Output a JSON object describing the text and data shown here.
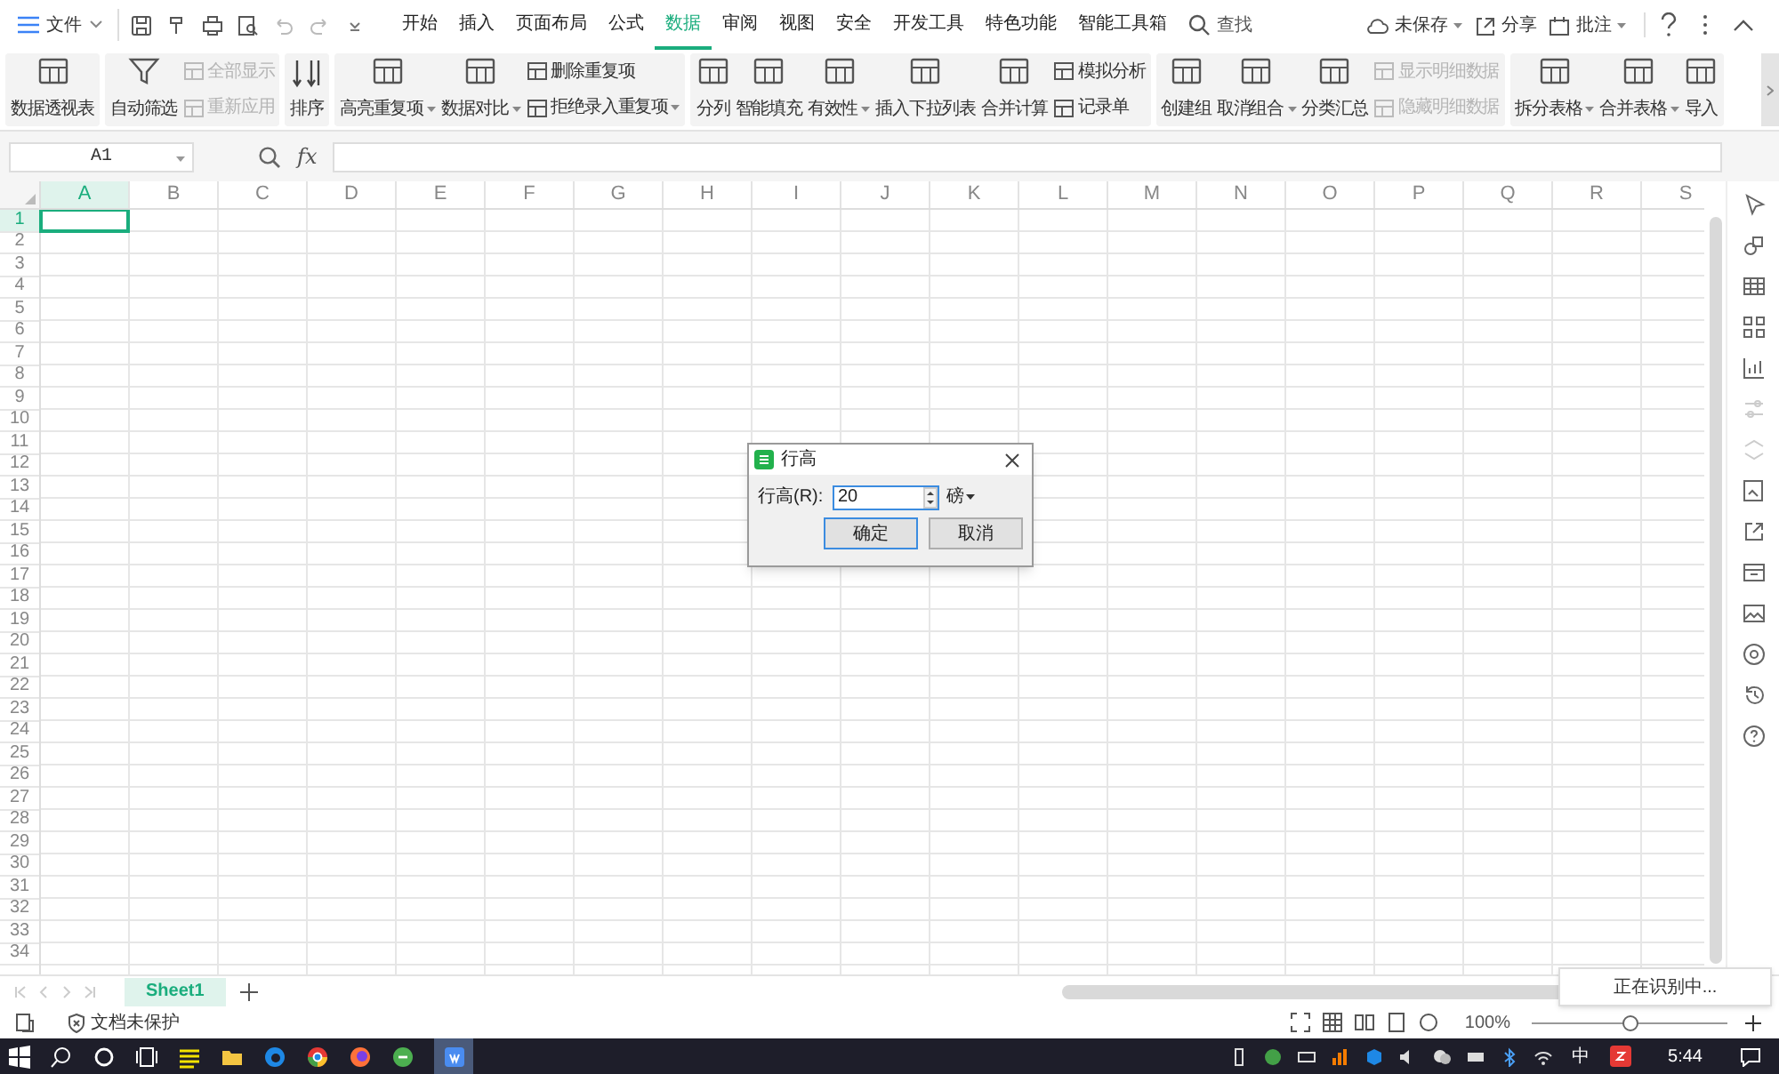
{
  "menu": {
    "file": "文件",
    "tabs": [
      {
        "label": "开始",
        "selected": false
      },
      {
        "label": "插入",
        "selected": false
      },
      {
        "label": "页面布局",
        "selected": false
      },
      {
        "label": "公式",
        "selected": false
      },
      {
        "label": "数据",
        "selected": true
      },
      {
        "label": "审阅",
        "selected": false
      },
      {
        "label": "视图",
        "selected": false
      },
      {
        "label": "安全",
        "selected": false
      },
      {
        "label": "开发工具",
        "selected": false
      },
      {
        "label": "特色功能",
        "selected": false
      },
      {
        "label": "智能工具箱",
        "selected": false
      }
    ],
    "search": "查找",
    "right": [
      {
        "kind": "cloud",
        "label": "未保存",
        "dropdown": true
      },
      {
        "kind": "share",
        "label": "分享",
        "dropdown": false
      },
      {
        "kind": "comment",
        "label": "批注",
        "dropdown": true
      }
    ]
  },
  "ribbon": [
    {
      "items": [
        {
          "kind": "large",
          "label": "数据透视表",
          "dropdown": false,
          "disabled": false
        }
      ]
    },
    {
      "items": [
        {
          "kind": "large",
          "label": "自动筛选",
          "dropdown": false,
          "disabled": false
        },
        {
          "kind": "stack",
          "rows": [
            {
              "label": "全部显示",
              "dropdown": false,
              "disabled": true
            },
            {
              "label": "重新应用",
              "dropdown": false,
              "disabled": true
            }
          ]
        }
      ]
    },
    {
      "items": [
        {
          "kind": "sort",
          "label": "排序",
          "dropdown": false,
          "disabled": false
        }
      ]
    },
    {
      "items": [
        {
          "kind": "large",
          "label": "高亮重复项",
          "dropdown": true,
          "disabled": false
        },
        {
          "kind": "large",
          "label": "数据对比",
          "dropdown": true,
          "disabled": false
        },
        {
          "kind": "stack",
          "rows": [
            {
              "label": "删除重复项",
              "dropdown": false,
              "disabled": false
            },
            {
              "label": "拒绝录入重复项",
              "dropdown": true,
              "disabled": false
            }
          ]
        }
      ]
    },
    {
      "items": [
        {
          "kind": "large",
          "label": "分列",
          "dropdown": false,
          "disabled": false
        },
        {
          "kind": "large",
          "label": "智能填充",
          "dropdown": false,
          "disabled": false
        },
        {
          "kind": "large",
          "label": "有效性",
          "dropdown": true,
          "disabled": false
        },
        {
          "kind": "large",
          "label": "插入下拉列表",
          "dropdown": false,
          "disabled": false
        },
        {
          "kind": "large",
          "label": "合并计算",
          "dropdown": false,
          "disabled": false
        },
        {
          "kind": "stack",
          "rows": [
            {
              "label": "模拟分析",
              "dropdown": false,
              "disabled": false
            },
            {
              "label": "记录单",
              "dropdown": false,
              "disabled": false
            }
          ]
        }
      ]
    },
    {
      "items": [
        {
          "kind": "large",
          "label": "创建组",
          "dropdown": false,
          "disabled": false
        },
        {
          "kind": "large",
          "label": "取消组合",
          "dropdown": true,
          "disabled": false
        },
        {
          "kind": "large",
          "label": "分类汇总",
          "dropdown": false,
          "disabled": false
        },
        {
          "kind": "stack",
          "rows": [
            {
              "label": "显示明细数据",
              "dropdown": false,
              "disabled": true
            },
            {
              "label": "隐藏明细数据",
              "dropdown": false,
              "disabled": true
            }
          ]
        }
      ]
    },
    {
      "items": [
        {
          "kind": "large",
          "label": "拆分表格",
          "dropdown": true,
          "disabled": false
        },
        {
          "kind": "large",
          "label": "合并表格",
          "dropdown": true,
          "disabled": false
        },
        {
          "kind": "large",
          "label": "导入",
          "dropdown": false,
          "disabled": false
        }
      ]
    }
  ],
  "formula_bar": {
    "cell": "A1",
    "fx": "fx"
  },
  "sheet": {
    "columns": [
      {
        "label": "A",
        "selected": true
      },
      {
        "label": "B",
        "selected": false
      },
      {
        "label": "C",
        "selected": false
      },
      {
        "label": "D",
        "selected": false
      },
      {
        "label": "E",
        "selected": false
      },
      {
        "label": "F",
        "selected": false
      },
      {
        "label": "G",
        "selected": false
      },
      {
        "label": "H",
        "selected": false
      },
      {
        "label": "I",
        "selected": false
      },
      {
        "label": "J",
        "selected": false
      },
      {
        "label": "K",
        "selected": false
      },
      {
        "label": "L",
        "selected": false
      },
      {
        "label": "M",
        "selected": false
      },
      {
        "label": "N",
        "selected": false
      },
      {
        "label": "O",
        "selected": false
      },
      {
        "label": "P",
        "selected": false
      },
      {
        "label": "Q",
        "selected": false
      },
      {
        "label": "R",
        "selected": false
      },
      {
        "label": "S",
        "selected": false
      }
    ],
    "rows": [
      {
        "label": "1",
        "selected": true
      },
      {
        "label": "2",
        "selected": false
      },
      {
        "label": "3",
        "selected": false
      },
      {
        "label": "4",
        "selected": false
      },
      {
        "label": "5",
        "selected": false
      },
      {
        "label": "6",
        "selected": false
      },
      {
        "label": "7",
        "selected": false
      },
      {
        "label": "8",
        "selected": false
      },
      {
        "label": "9",
        "selected": false
      },
      {
        "label": "10",
        "selected": false
      },
      {
        "label": "11",
        "selected": false
      },
      {
        "label": "12",
        "selected": false
      },
      {
        "label": "13",
        "selected": false
      },
      {
        "label": "14",
        "selected": false
      },
      {
        "label": "15",
        "selected": false
      },
      {
        "label": "16",
        "selected": false
      },
      {
        "label": "17",
        "selected": false
      },
      {
        "label": "18",
        "selected": false
      },
      {
        "label": "19",
        "selected": false
      },
      {
        "label": "20",
        "selected": false
      },
      {
        "label": "21",
        "selected": false
      },
      {
        "label": "22",
        "selected": false
      },
      {
        "label": "23",
        "selected": false
      },
      {
        "label": "24",
        "selected": false
      },
      {
        "label": "25",
        "selected": false
      },
      {
        "label": "26",
        "selected": false
      },
      {
        "label": "27",
        "selected": false
      },
      {
        "label": "28",
        "selected": false
      },
      {
        "label": "29",
        "selected": false
      },
      {
        "label": "30",
        "selected": false
      },
      {
        "label": "31",
        "selected": false
      },
      {
        "label": "32",
        "selected": false
      },
      {
        "label": "33",
        "selected": false
      },
      {
        "label": "34",
        "selected": false
      }
    ]
  },
  "dialog": {
    "title": "行高",
    "label": "行高(R):",
    "value": "20",
    "unit": "磅",
    "buttons": [
      {
        "label": "确定",
        "default": true
      },
      {
        "label": "取消",
        "default": false
      }
    ]
  },
  "sheet_tabs": [
    {
      "label": "Sheet1",
      "selected": true
    }
  ],
  "toast": "正在识别中...",
  "status_bar": {
    "protection": "文档未保护",
    "zoom": "100%",
    "zoom_slider": {
      "level": 0.5
    }
  },
  "taskbar": {
    "ime": "中",
    "time": "5:44"
  }
}
